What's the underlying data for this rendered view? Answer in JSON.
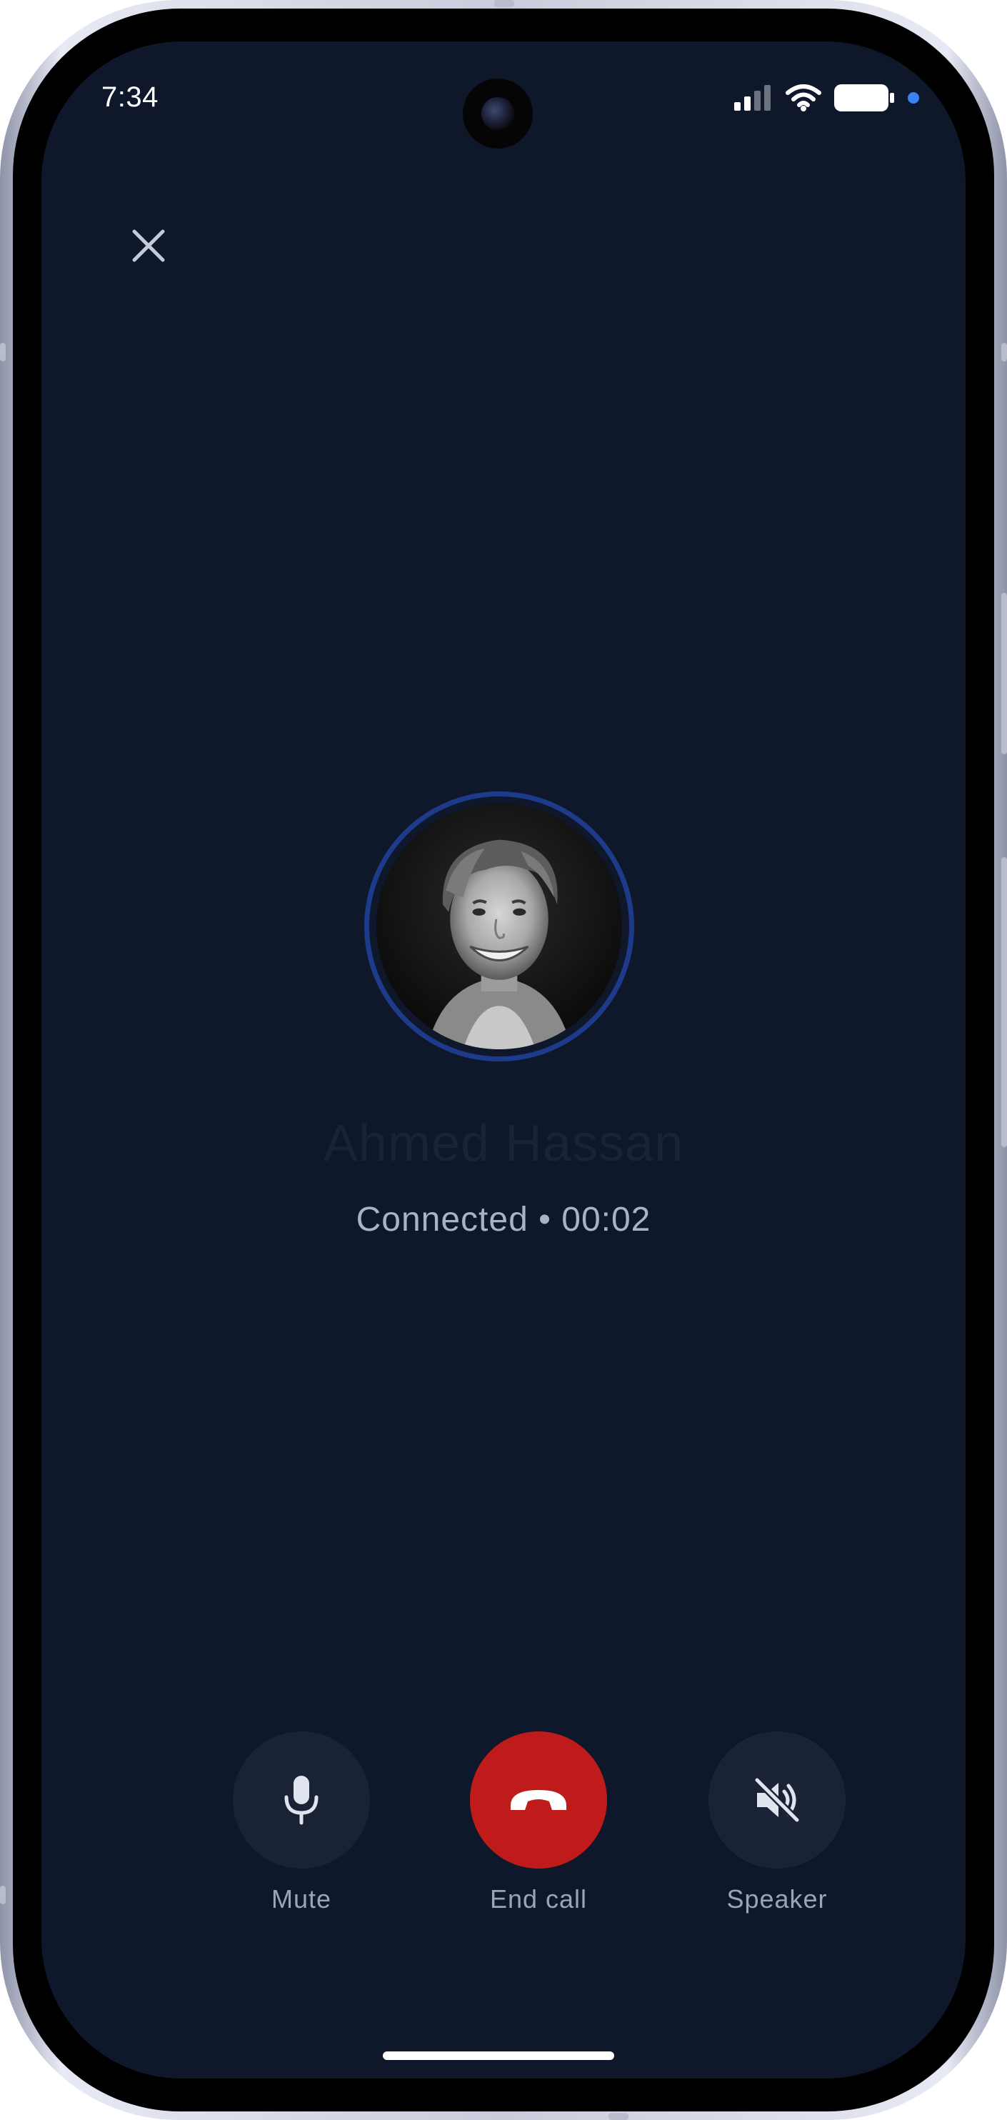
{
  "status_bar": {
    "time": "7:34"
  },
  "contact": {
    "name": "Ahmed Hassan"
  },
  "call": {
    "status": "Connected • 00:02"
  },
  "controls": {
    "mute_label": "Mute",
    "end_label": "End call",
    "speaker_label": "Speaker"
  },
  "colors": {
    "background": "#0f172a",
    "end_call": "#bf1b1b",
    "control_button": "#1a2335",
    "avatar_ring": "#1e3a8a",
    "status_dot": "#3b82f6"
  },
  "icons": {
    "close": "close-icon",
    "mute": "microphone-icon",
    "end_call": "phone-hangup-icon",
    "speaker": "speaker-muted-icon"
  }
}
